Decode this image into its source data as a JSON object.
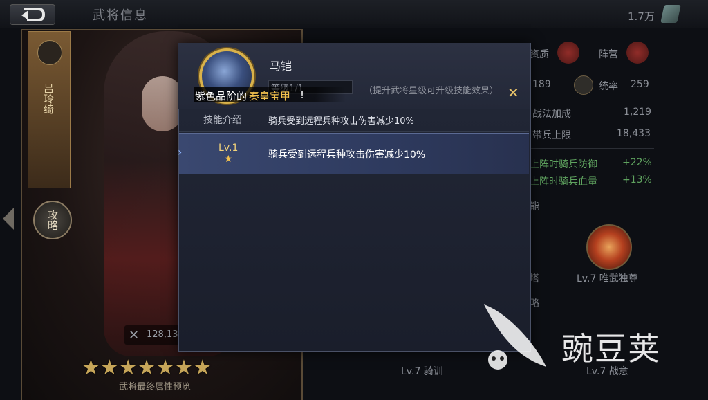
{
  "header": {
    "title": "武将信息",
    "currency_value": "1.7万",
    "currency_icon": "jade-icon"
  },
  "hero": {
    "name_vertical": "吕玲绮",
    "guide_label": "攻略",
    "power_value": "128,13",
    "star_glyphs": "★★★★★★★",
    "star_count": 7,
    "final_preview_label": "武将最终属性预览"
  },
  "stats": {
    "quality_label": "资质",
    "camp_label": "阵营",
    "value_189": "189",
    "command_label": "统率",
    "command_value": "259",
    "tactic_bonus_label": "战法加成",
    "tactic_bonus_value": "1,219",
    "troop_limit_label": "带兵上限",
    "troop_limit_value": "18,433",
    "cav_def_label": "上阵时骑兵防御",
    "cav_def_value": "+22%",
    "cav_hp_label": "上阵时骑兵血量",
    "cav_hp_value": "+13%",
    "section_skill_fragment": "能",
    "skill_right_label": "Lv.7 唯武独尊",
    "skill_left_fragment": "塔",
    "section_strategy_fragment": "略",
    "bottom_skill_1": "Lv.7 骑训",
    "bottom_skill_2": "Lv.7 战意"
  },
  "modal": {
    "skill_name": "马铠",
    "level_text": "等级1/1",
    "upgrade_hint": "（提升武将星级可升级技能效果）",
    "banner_part_a": "紫色品阶的",
    "banner_part_b": "秦皇宝甲",
    "banner_part_c": "!",
    "intro_label": "技能介绍",
    "intro_desc": "骑兵受到远程兵种攻击伤害减少10%",
    "level_label": "Lv.1",
    "level_desc": "骑兵受到远程兵种攻击伤害减少10%"
  },
  "watermark": {
    "text": "豌豆荚"
  },
  "colors": {
    "accent_gold": "#f2c14e",
    "modal_bg": "#1a1e2b",
    "highlight_row": "#3a4870",
    "positive_green": "#5fa35f"
  }
}
